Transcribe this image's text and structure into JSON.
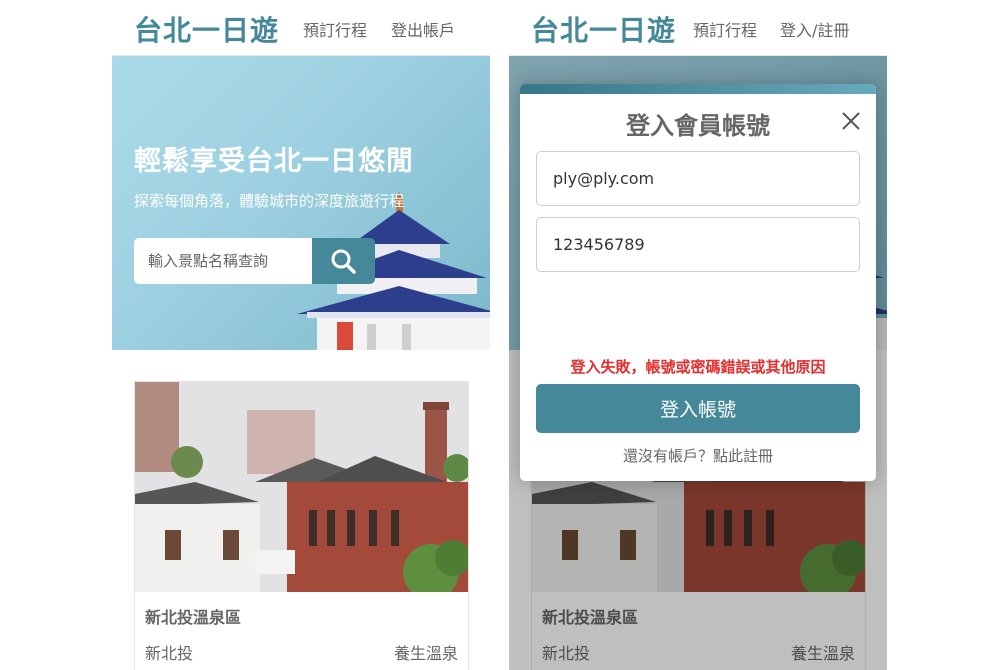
{
  "nav": {
    "brand": "台北一日遊",
    "book_link": "預訂行程",
    "logout_link": "登出帳戶",
    "login_link": "登入/註冊"
  },
  "hero": {
    "title": "輕鬆享受台北一日悠閒",
    "subtitle": "探索每個角落，體驗城市的深度旅遊行程",
    "search_placeholder": "輸入景點名稱查詢"
  },
  "card": {
    "title": "新北投溫泉區",
    "location": "新北投",
    "category": "養生溫泉"
  },
  "login_modal": {
    "title": "登入會員帳號",
    "email_value": "ply@ply.com",
    "password_value": "123456789",
    "error_message": "登入失敗，帳號或密碼錯誤或其他原因",
    "submit_label": "登入帳號",
    "signup_prompt": "還沒有帳戶？點此註冊"
  },
  "icons": {
    "search": "search-icon",
    "close": "close-icon"
  },
  "colors": {
    "brand": "#448899",
    "error": "#e62e2e",
    "text": "#666666"
  }
}
